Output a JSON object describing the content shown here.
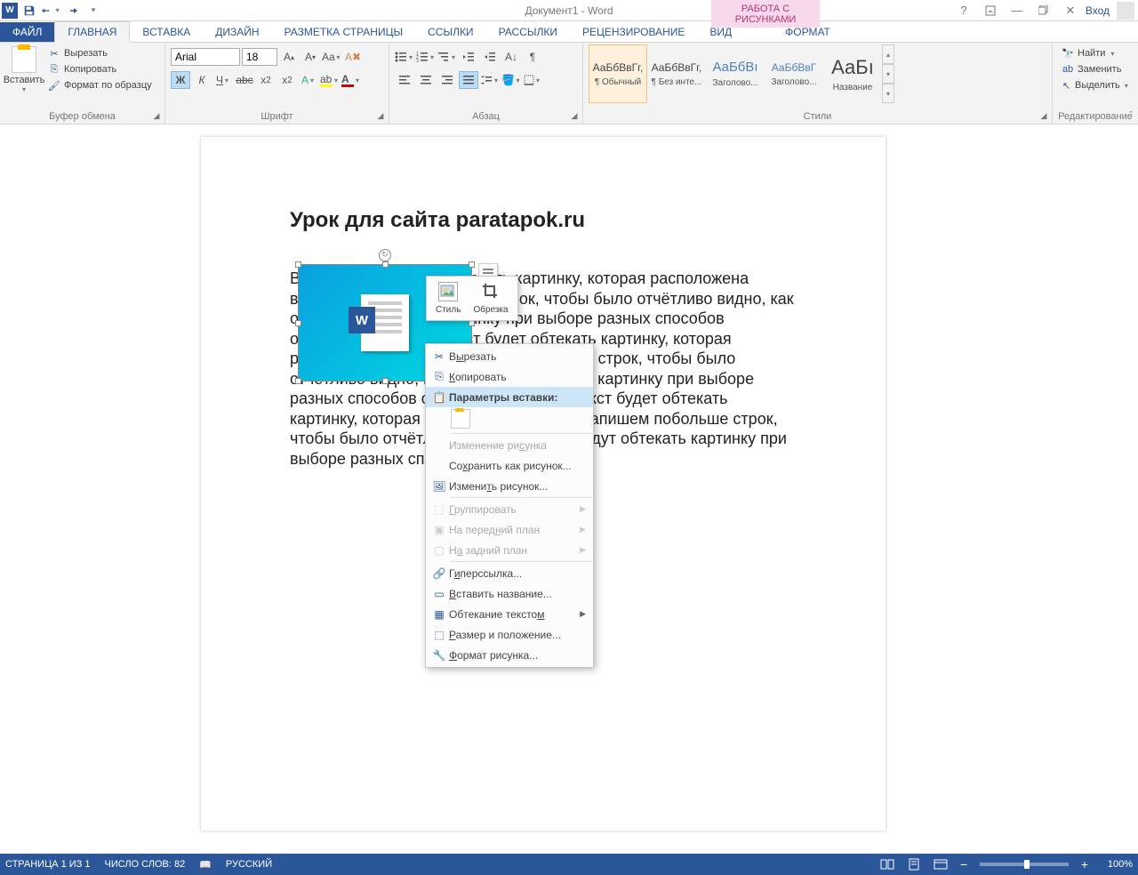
{
  "titlebar": {
    "title": "Документ1 - Word",
    "tool_tab": "РАБОТА С РИСУНКАМИ",
    "login": "Вход"
  },
  "tabs": {
    "file": "ФАЙЛ",
    "home": "ГЛАВНАЯ",
    "insert": "ВСТАВКА",
    "design": "ДИЗАЙН",
    "layout": "РАЗМЕТКА СТРАНИЦЫ",
    "refs": "ССЫЛКИ",
    "mail": "РАССЫЛКИ",
    "review": "РЕЦЕНЗИРОВАНИЕ",
    "view": "ВИД",
    "format": "ФОРМАТ"
  },
  "ribbon": {
    "clipboard": {
      "paste": "Вставить",
      "cut": "Вырезать",
      "copy": "Копировать",
      "format_painter": "Формат по образцу",
      "label": "Буфер обмена"
    },
    "font": {
      "name": "Arial",
      "size": "18",
      "label": "Шрифт"
    },
    "paragraph": {
      "label": "Абзац"
    },
    "styles": {
      "items": [
        {
          "preview": "АаБбВвГг,",
          "name": "¶ Обычный"
        },
        {
          "preview": "АаБбВвГг,",
          "name": "¶ Без инте..."
        },
        {
          "preview": "АаБбВı",
          "name": "Заголово..."
        },
        {
          "preview": "АаБбВвГ",
          "name": "Заголово..."
        },
        {
          "preview": "АаБı",
          "name": "Название"
        }
      ],
      "label": "Стили"
    },
    "editing": {
      "find": "Найти",
      "replace": "Заменить",
      "select": "Выделить",
      "label": "Редактирование"
    }
  },
  "document": {
    "heading": "Урок для сайта paratapok.ru",
    "body": "Вот этот текст будет обтекать картинку, которая расположена выше. Напишем побольше строк, чтобы было отчётливо видно, как они будут обтекать картинку при выборе разных способов обтекания. Вот этот текст будет обтекать картинку, которая расположена выше. Напишем побольше строк, чтобы было отчётливо видно, как они будут обтекать картинку при выборе разных способов обтекания. Вот этот текст будет обтекать картинку, которая расположена выше. Напишем побольше строк, чтобы было отчётливо видно, как они будут обтекать картинку при выборе разных способов обтекания."
  },
  "mini_toolbar": {
    "style": "Стиль",
    "crop": "Обрезка"
  },
  "context_menu": {
    "cut": "Вырезать",
    "copy": "Копировать",
    "paste_options": "Параметры вставки:",
    "edit_picture": "Изменение рисунка",
    "save_as_picture": "Сохранить как рисунок...",
    "change_picture": "Изменить рисунок...",
    "group": "Группировать",
    "bring_front": "На передний план",
    "send_back": "На задний план",
    "hyperlink": "Гиперссылка...",
    "insert_caption": "Вставить название...",
    "text_wrapping": "Обтекание текстом",
    "size_position": "Размер и положение...",
    "format_picture": "Формат рисунка..."
  },
  "statusbar": {
    "page": "СТРАНИЦА 1 ИЗ 1",
    "words": "ЧИСЛО СЛОВ: 82",
    "lang": "РУССКИЙ",
    "zoom": "100%"
  },
  "colors": {
    "accent": "#2b579a",
    "tool_tab_bg": "#f8d9ec",
    "tool_tab_fg": "#b83074"
  }
}
